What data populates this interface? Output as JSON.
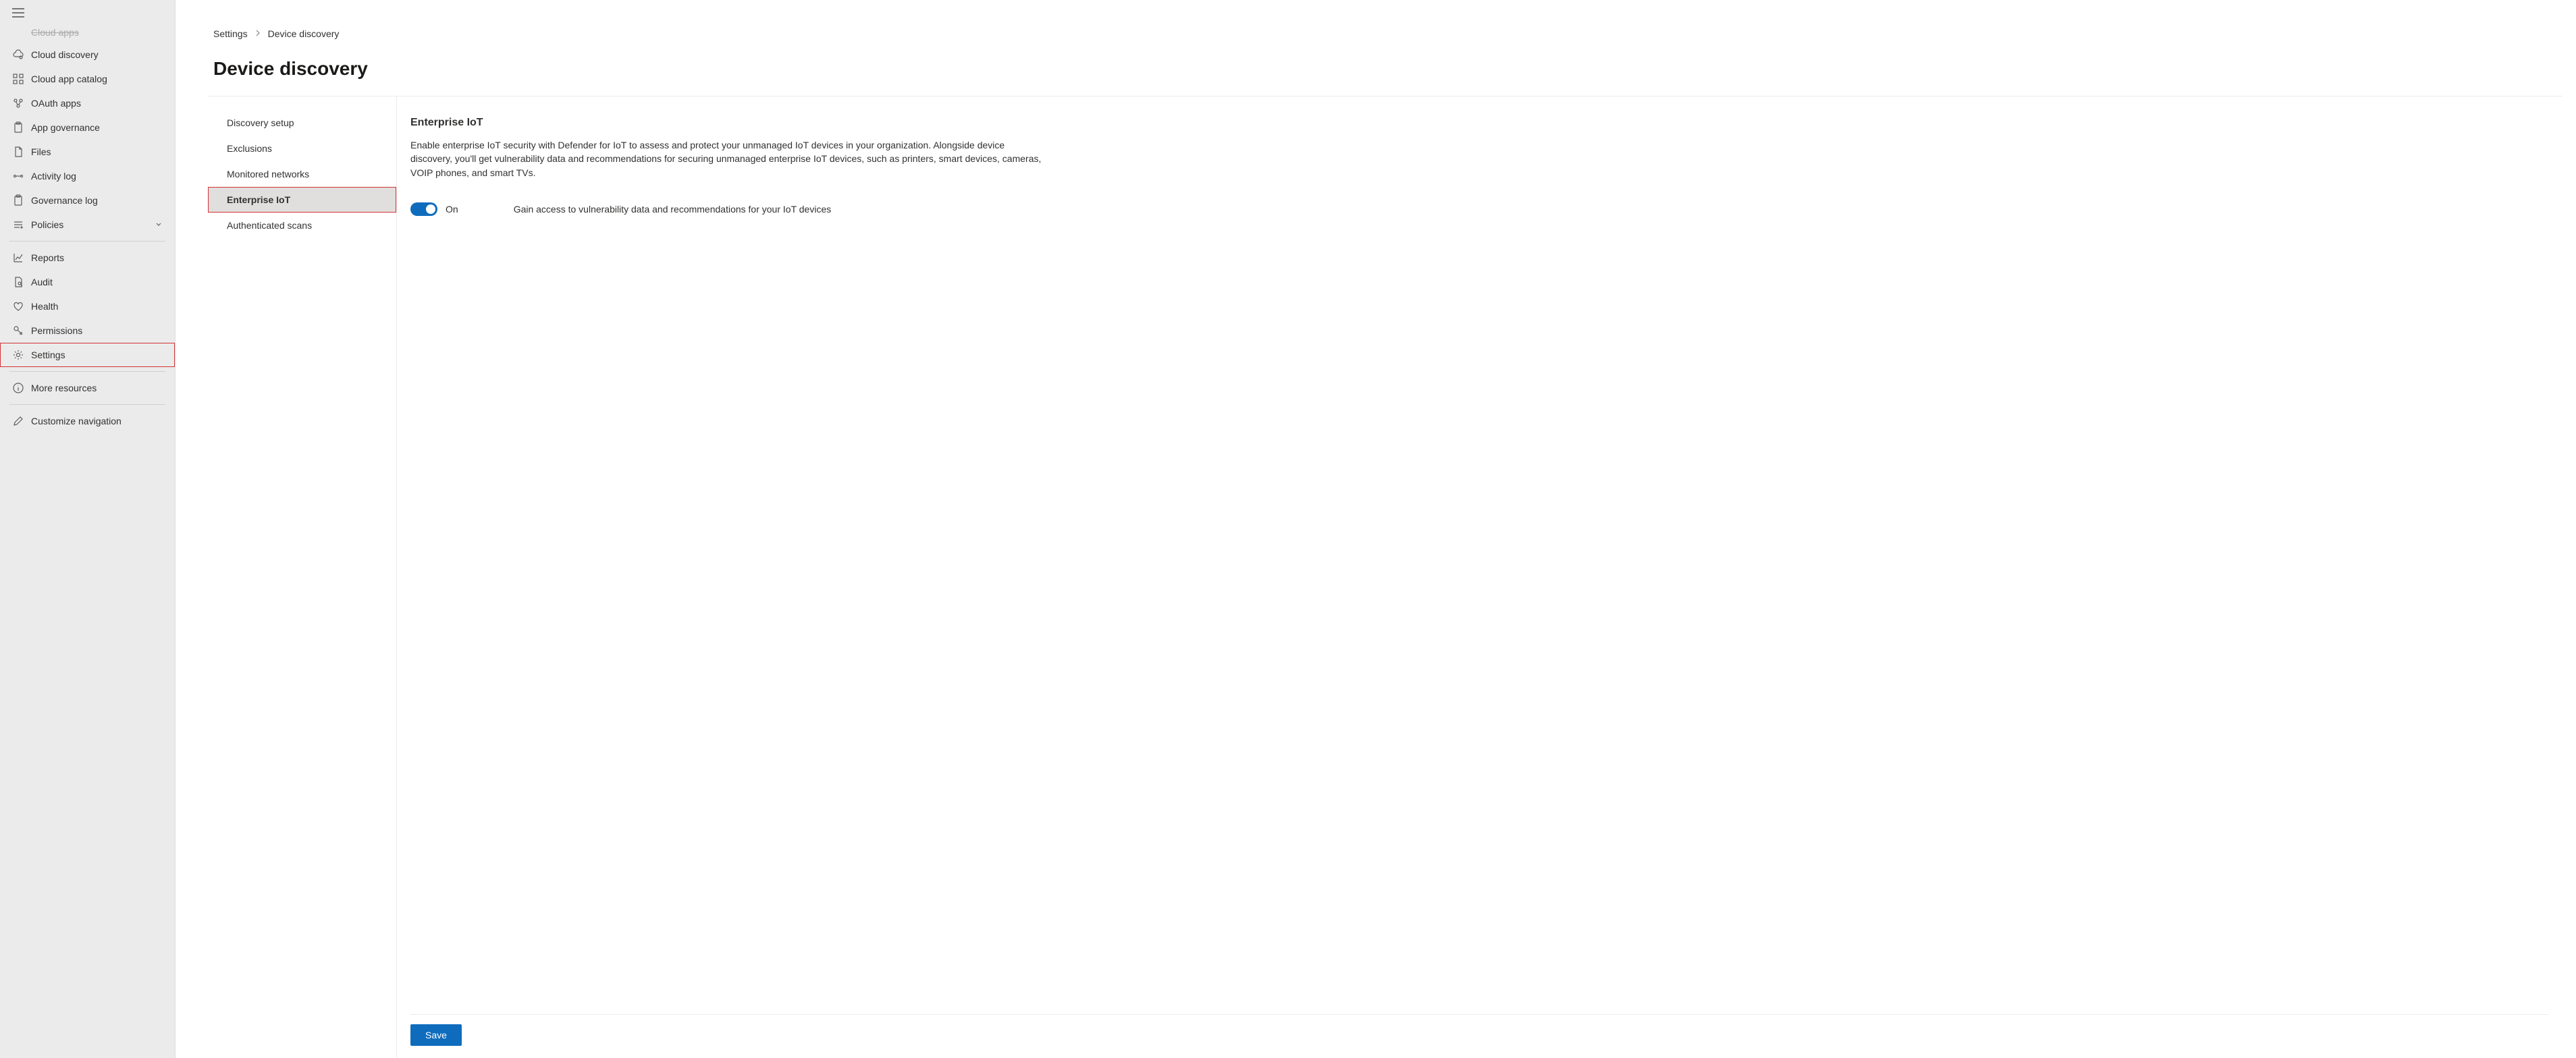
{
  "sidebar": {
    "truncated_top": "Cloud apps",
    "items": [
      {
        "label": "Cloud discovery",
        "icon": "cloud-discovery"
      },
      {
        "label": "Cloud app catalog",
        "icon": "catalog"
      },
      {
        "label": "OAuth apps",
        "icon": "oauth"
      },
      {
        "label": "App governance",
        "icon": "clipboard"
      },
      {
        "label": "Files",
        "icon": "files"
      },
      {
        "label": "Activity log",
        "icon": "activity"
      },
      {
        "label": "Governance log",
        "icon": "clipboard"
      },
      {
        "label": "Policies",
        "icon": "policies",
        "expandable": true
      }
    ],
    "group2": [
      {
        "label": "Reports",
        "icon": "reports"
      },
      {
        "label": "Audit",
        "icon": "audit"
      },
      {
        "label": "Health",
        "icon": "health"
      },
      {
        "label": "Permissions",
        "icon": "permissions"
      },
      {
        "label": "Settings",
        "icon": "settings",
        "highlighted": true
      }
    ],
    "group3": [
      {
        "label": "More resources",
        "icon": "info"
      }
    ],
    "group4": [
      {
        "label": "Customize navigation",
        "icon": "edit"
      }
    ]
  },
  "breadcrumb": {
    "parent": "Settings",
    "current": "Device discovery"
  },
  "page_title": "Device discovery",
  "subnav": [
    {
      "label": "Discovery setup"
    },
    {
      "label": "Exclusions"
    },
    {
      "label": "Monitored networks"
    },
    {
      "label": "Enterprise IoT",
      "active": true,
      "highlighted": true
    },
    {
      "label": "Authenticated scans"
    }
  ],
  "detail": {
    "section_title": "Enterprise IoT",
    "section_desc": "Enable enterprise IoT security with Defender for IoT to assess and protect your unmanaged IoT devices in your organization. Alongside device discovery, you'll get vulnerability data and recommendations for securing unmanaged enterprise IoT devices, such as printers, smart devices, cameras, VOIP phones, and smart TVs.",
    "toggle_state": "On",
    "toggle_desc": "Gain access to vulnerability data and recommendations for your IoT devices",
    "save_label": "Save"
  }
}
